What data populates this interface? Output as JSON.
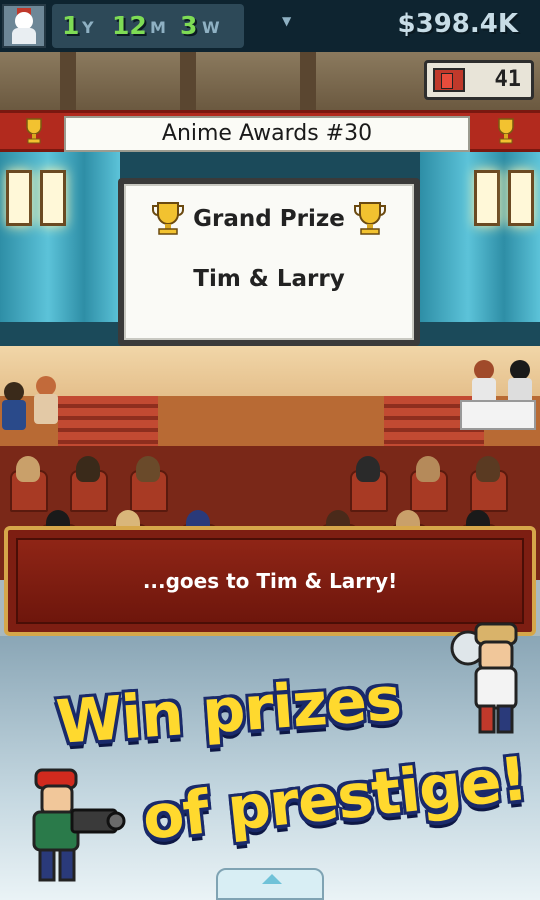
{
  "hud": {
    "years": "1",
    "years_unit": "Y",
    "months": "12",
    "months_unit": "M",
    "weeks": "3",
    "weeks_unit": "W",
    "money": "$398.4K",
    "items_count": "41"
  },
  "ceremony": {
    "banner_title": "Anime Awards #30",
    "prize_title": "Grand Prize",
    "winner": "Tim & Larry"
  },
  "dialog": {
    "message": "...goes to Tim & Larry!"
  },
  "promo": {
    "line1": "Win prizes",
    "line2": "of prestige!"
  },
  "colors": {
    "hud_bg": "#0e2430",
    "date_green": "#7edc55",
    "banner_red": "#b22a1e",
    "dialog_red": "#7d1e12",
    "promo_yellow": "#ffd92e",
    "promo_outline": "#1a2a6a"
  },
  "icons": {
    "avatar": "snowman-avatar-icon",
    "calendar_dropdown": "chevron-down-icon",
    "items": "book-stack-icon",
    "trophy": "trophy-icon",
    "scroll_up": "chevron-up-icon"
  }
}
